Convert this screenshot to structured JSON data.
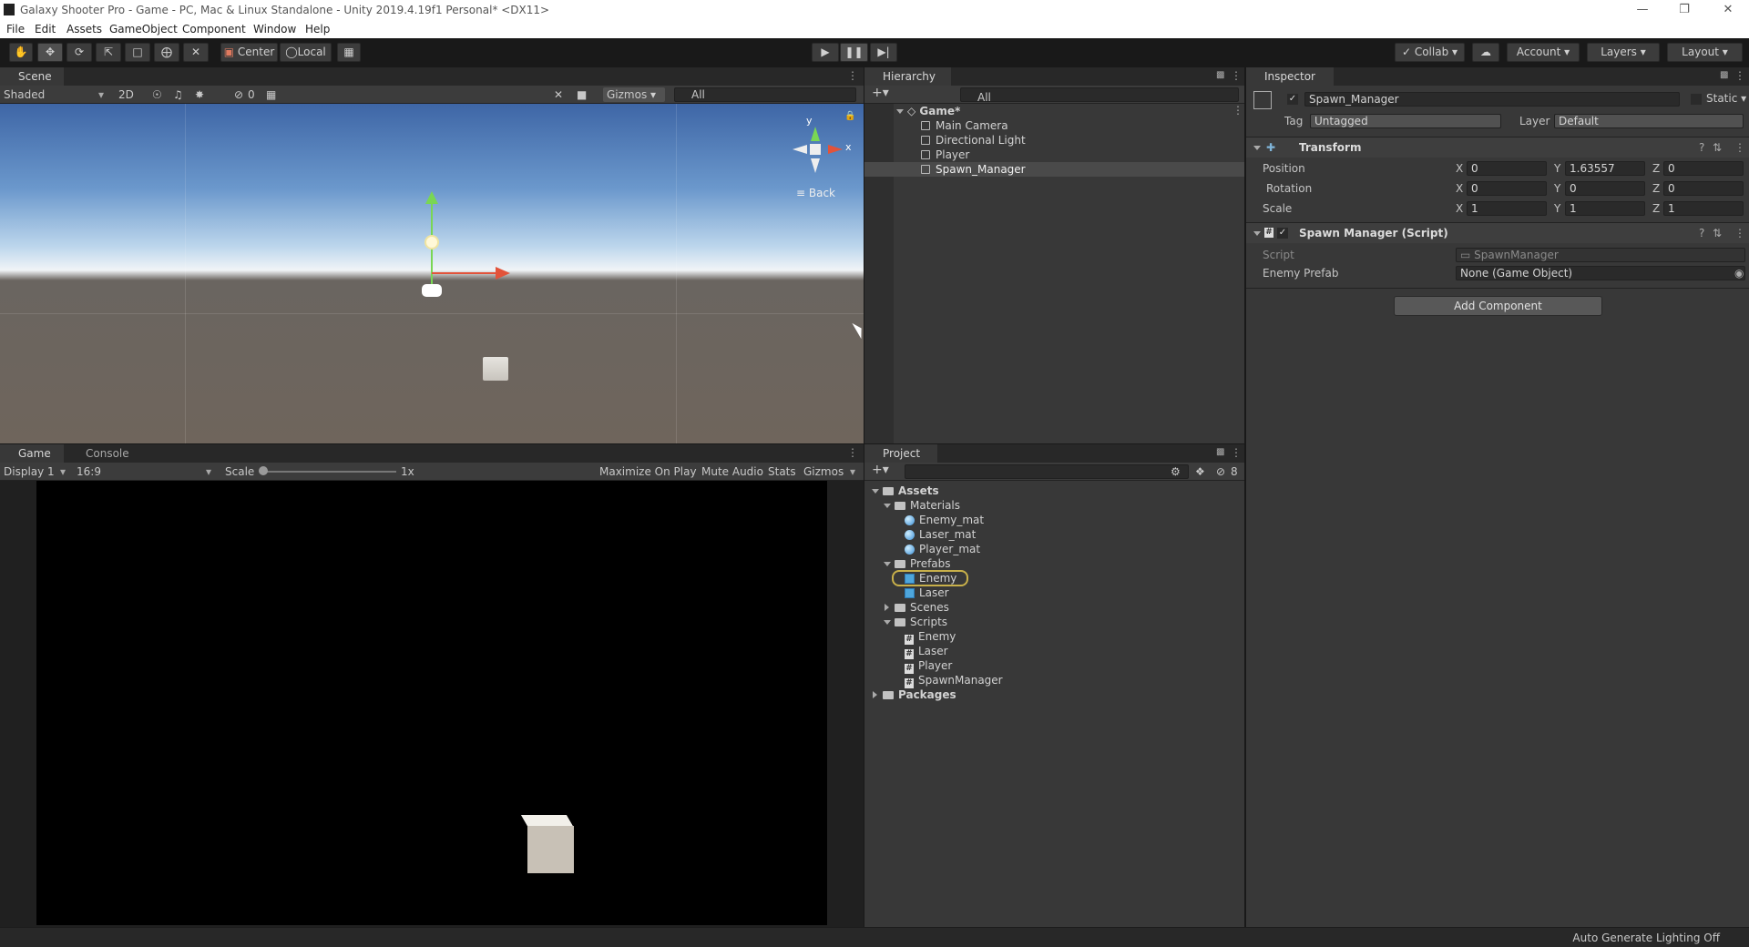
{
  "window": {
    "title": "Galaxy Shooter Pro - Game - PC, Mac & Linux Standalone - Unity 2019.4.19f1 Personal* <DX11>"
  },
  "menu": [
    "File",
    "Edit",
    "Assets",
    "GameObject",
    "Component",
    "Window",
    "Help"
  ],
  "toolbar": {
    "center": "Center",
    "local": "Local",
    "collab": "Collab",
    "account": "Account",
    "layers": "Layers",
    "layout": "Layout"
  },
  "scene": {
    "tab": "Scene",
    "shading": "Shaded",
    "mode2d": "2D",
    "hidden_count": "0",
    "gizmos": "Gizmos",
    "search_placeholder": "All",
    "view_label": "Back",
    "axis_y": "y",
    "axis_x": "x"
  },
  "game": {
    "tab": "Game",
    "console_tab": "Console",
    "display": "Display 1",
    "aspect": "16:9",
    "scale_label": "Scale",
    "scale_value": "1x",
    "maximize": "Maximize On Play",
    "mute": "Mute Audio",
    "stats": "Stats",
    "gizmos": "Gizmos"
  },
  "hierarchy": {
    "tab": "Hierarchy",
    "search_placeholder": "All",
    "scene": "Game*",
    "items": [
      "Main Camera",
      "Directional Light",
      "Player",
      "Spawn_Manager"
    ]
  },
  "project": {
    "tab": "Project",
    "hidden_count": "8",
    "assets": "Assets",
    "materials": "Materials",
    "materials_items": [
      "Enemy_mat",
      "Laser_mat",
      "Player_mat"
    ],
    "prefabs": "Prefabs",
    "prefabs_items": [
      "Enemy",
      "Laser"
    ],
    "scenes": "Scenes",
    "scripts": "Scripts",
    "scripts_items": [
      "Enemy",
      "Laser",
      "Player",
      "SpawnManager"
    ],
    "packages": "Packages"
  },
  "inspector": {
    "tab": "Inspector",
    "object_name": "Spawn_Manager",
    "static": "Static",
    "tag_label": "Tag",
    "tag_value": "Untagged",
    "layer_label": "Layer",
    "layer_value": "Default",
    "transform": {
      "title": "Transform",
      "position": {
        "label": "Position",
        "x": "0",
        "y": "1.63557",
        "z": "0"
      },
      "rotation": {
        "label": "Rotation",
        "x": "0",
        "y": "0",
        "z": "0"
      },
      "scale": {
        "label": "Scale",
        "x": "1",
        "y": "1",
        "z": "1"
      }
    },
    "script_component": {
      "title": "Spawn Manager (Script)",
      "script_label": "Script",
      "script_value": "SpawnManager",
      "enemy_prefab_label": "Enemy Prefab",
      "enemy_prefab_value": "None (Game Object)"
    },
    "add_component": "Add Component"
  },
  "status": {
    "text": "Auto Generate Lighting Off"
  },
  "colors": {
    "accent_selected": "#2c5d87",
    "prefab_highlight": "#c8b04a"
  }
}
